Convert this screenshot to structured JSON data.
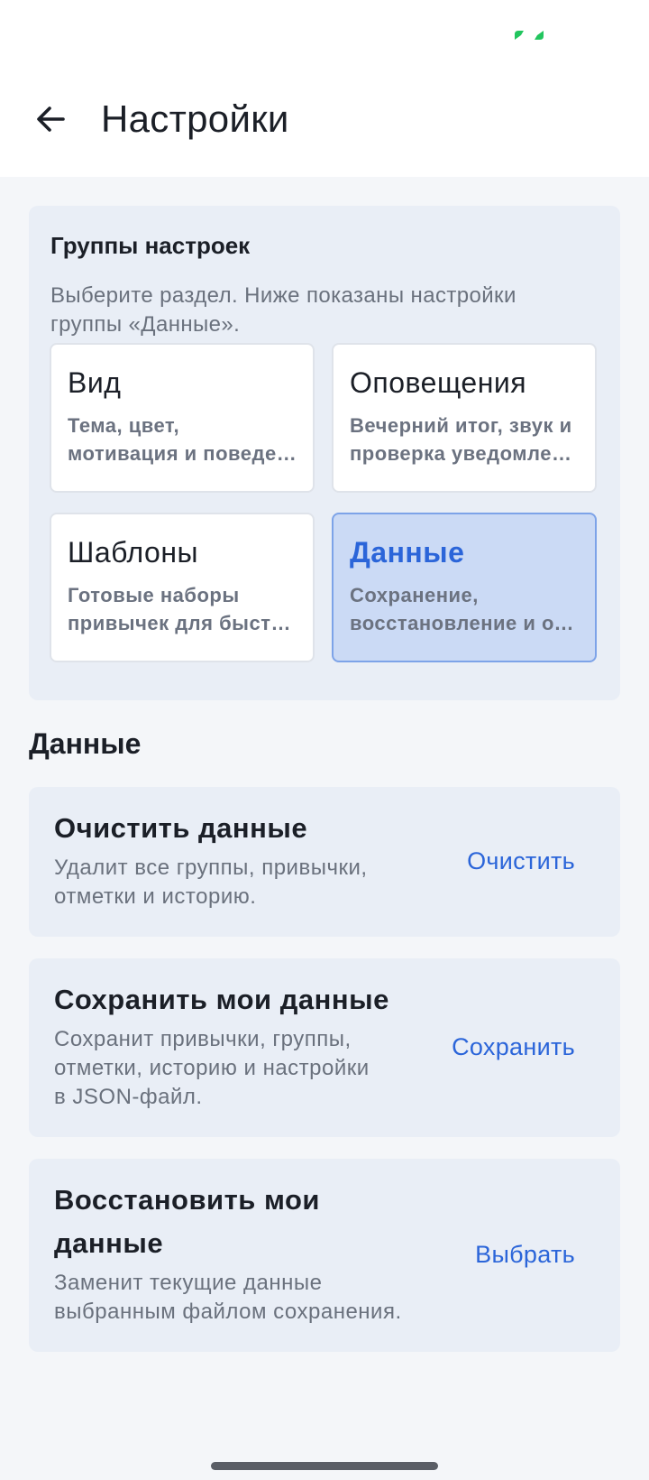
{
  "app_bar": {
    "title": "Настройки"
  },
  "groups": {
    "title": "Группы настроек",
    "description_lines": [
      "Выберите раздел. Ниже показаны настройки",
      "группы «Данные»."
    ],
    "tiles": [
      {
        "title": "Вид",
        "desc_lines": [
          "Тема, цвет,",
          "мотивация и поведение"
        ],
        "selected": false
      },
      {
        "title": "Оповещения",
        "desc_lines": [
          "Вечерний итог, звук и",
          "проверка уведомлений"
        ],
        "selected": false
      },
      {
        "title": "Шаблоны",
        "desc_lines": [
          "Готовые наборы",
          "привычек для быстрого"
        ],
        "selected": false
      },
      {
        "title": "Данные",
        "desc_lines": [
          "Сохранение,",
          "восстановление и очистка"
        ],
        "selected": true
      }
    ]
  },
  "section": {
    "heading": "Данные"
  },
  "actions": [
    {
      "title_lines": [
        "Очистить данные"
      ],
      "desc_lines": [
        "Удалит все группы, привычки,",
        "отметки и историю."
      ],
      "button": "Очистить"
    },
    {
      "title_lines": [
        "Сохранить мои данные"
      ],
      "desc_lines": [
        "Сохранит привычки, группы,",
        "отметки, историю и настройки",
        "в JSON-файл."
      ],
      "button": "Сохранить"
    },
    {
      "title_lines": [
        "Восстановить мои",
        "данные"
      ],
      "desc_lines": [
        "Заменит текущие данные",
        "выбранным файлом сохранения."
      ],
      "button": "Выбрать"
    }
  ],
  "colors": {
    "accent": "#2b65d9",
    "status_icon": "#22c55e",
    "selected_tile": "#cbdaf5"
  },
  "icons": {
    "back": "arrow-left-icon",
    "status": "status-indicator-icon"
  }
}
